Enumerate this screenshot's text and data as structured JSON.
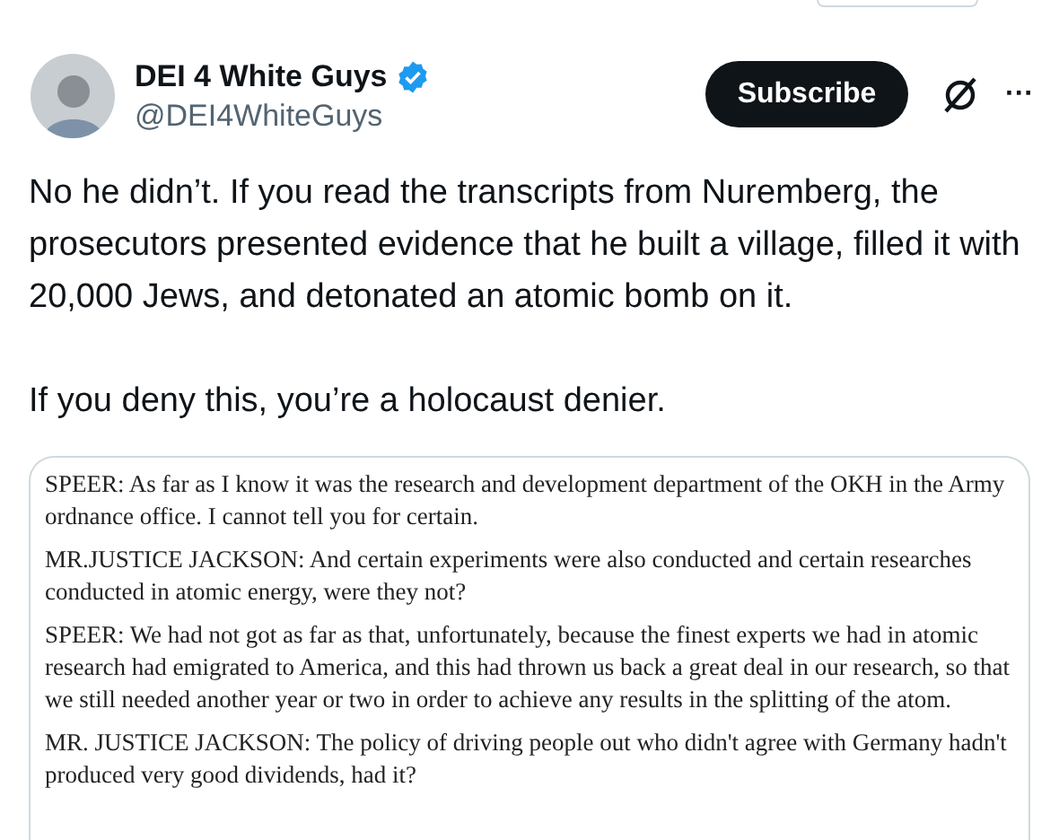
{
  "author": {
    "name": "DEI 4 White Guys",
    "verified": true,
    "handle": "@DEI4WhiteGuys"
  },
  "subscribe_button": "Subscribe",
  "more_button": "···",
  "tweet_paragraphs": [
    "No he didn’t. If you read the transcripts from Nuremberg, the prosecutors presented evidence that he built a village, filled it with 20,000 Jews, and detonated an atomic bomb on it.",
    "If you deny this, you’re a holocaust denier."
  ],
  "attached_document": {
    "paragraphs": [
      "SPEER: As far as I know it was the research and development department of the OKH in the Army ordnance office. I cannot tell you for certain.",
      "MR.JUSTICE JACKSON: And certain experiments were also conducted and certain researches conducted in atomic energy, were they not?",
      "SPEER: We had not got as far as that, unfortunately, because the finest experts we had in atomic research had emigrated to America, and this had thrown us back a great deal in our research, so that we still needed another year or two in order to achieve any results in the splitting of the atom.",
      "MR. JUSTICE JACKSON: The policy of driving people out who didn't agree with Germany hadn't produced very good dividends, had it?"
    ]
  }
}
